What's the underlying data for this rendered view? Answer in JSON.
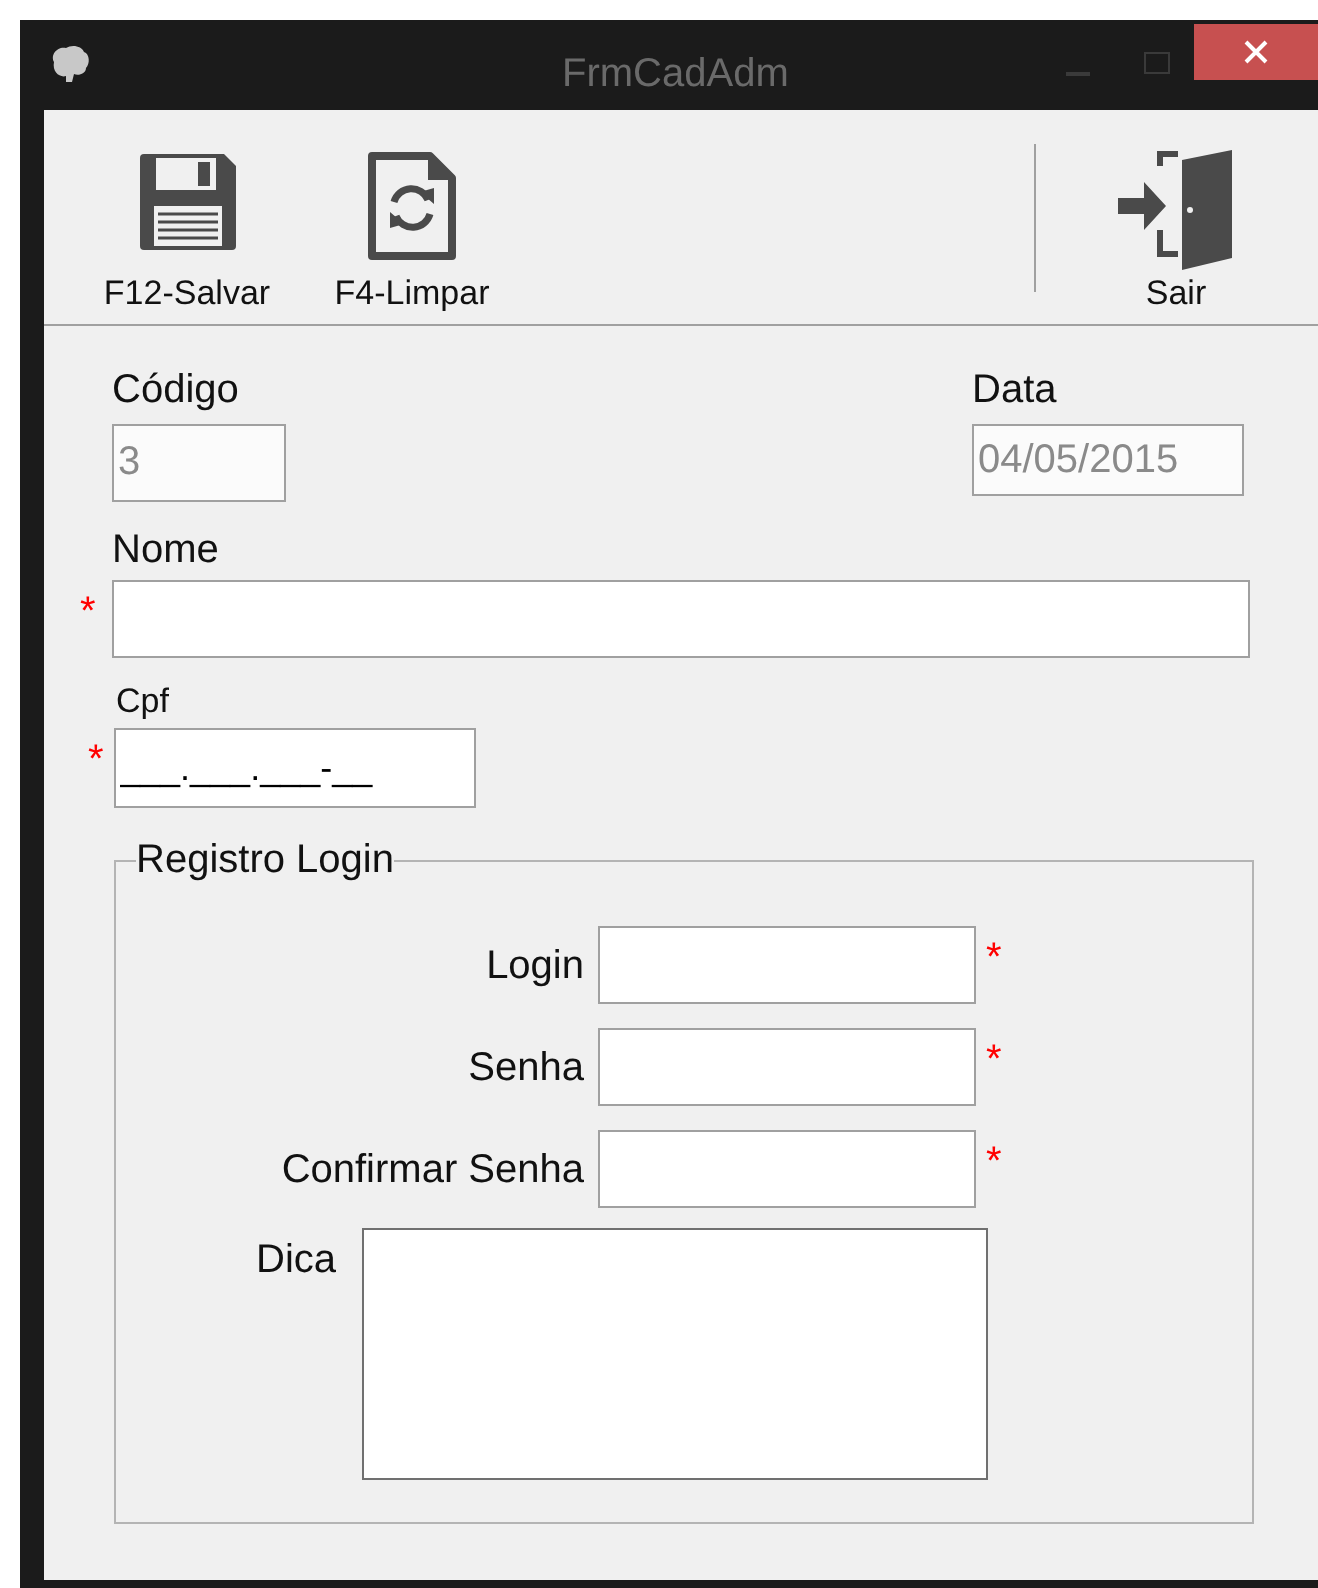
{
  "window": {
    "title": "FrmCadAdm"
  },
  "toolbar": [
    {
      "label": "F12-Salvar",
      "kind": "save"
    },
    {
      "label": "F4-Limpar",
      "kind": "clear"
    },
    {
      "label": "Sair",
      "kind": "exit"
    }
  ],
  "codigo": {
    "label": "Código",
    "value": "3",
    "disabled": true
  },
  "data": {
    "label": "Data",
    "value": "04/05/2015",
    "disabled": true
  },
  "nome": {
    "label": "Nome",
    "required_mark": "*"
  },
  "cpf": {
    "label": "Cpf",
    "value": "___.___.___-__",
    "required_mark": "*"
  },
  "registro_login": {
    "legend": "Registro Login",
    "fields": [
      {
        "label": "Login",
        "kind": "text",
        "required_mark": "*"
      },
      {
        "label": "Senha",
        "kind": "text",
        "required_mark": "*"
      },
      {
        "label": "Confirmar Senha",
        "kind": "text",
        "required_mark": "*"
      },
      {
        "label": "Dica",
        "kind": "multiline"
      }
    ]
  }
}
